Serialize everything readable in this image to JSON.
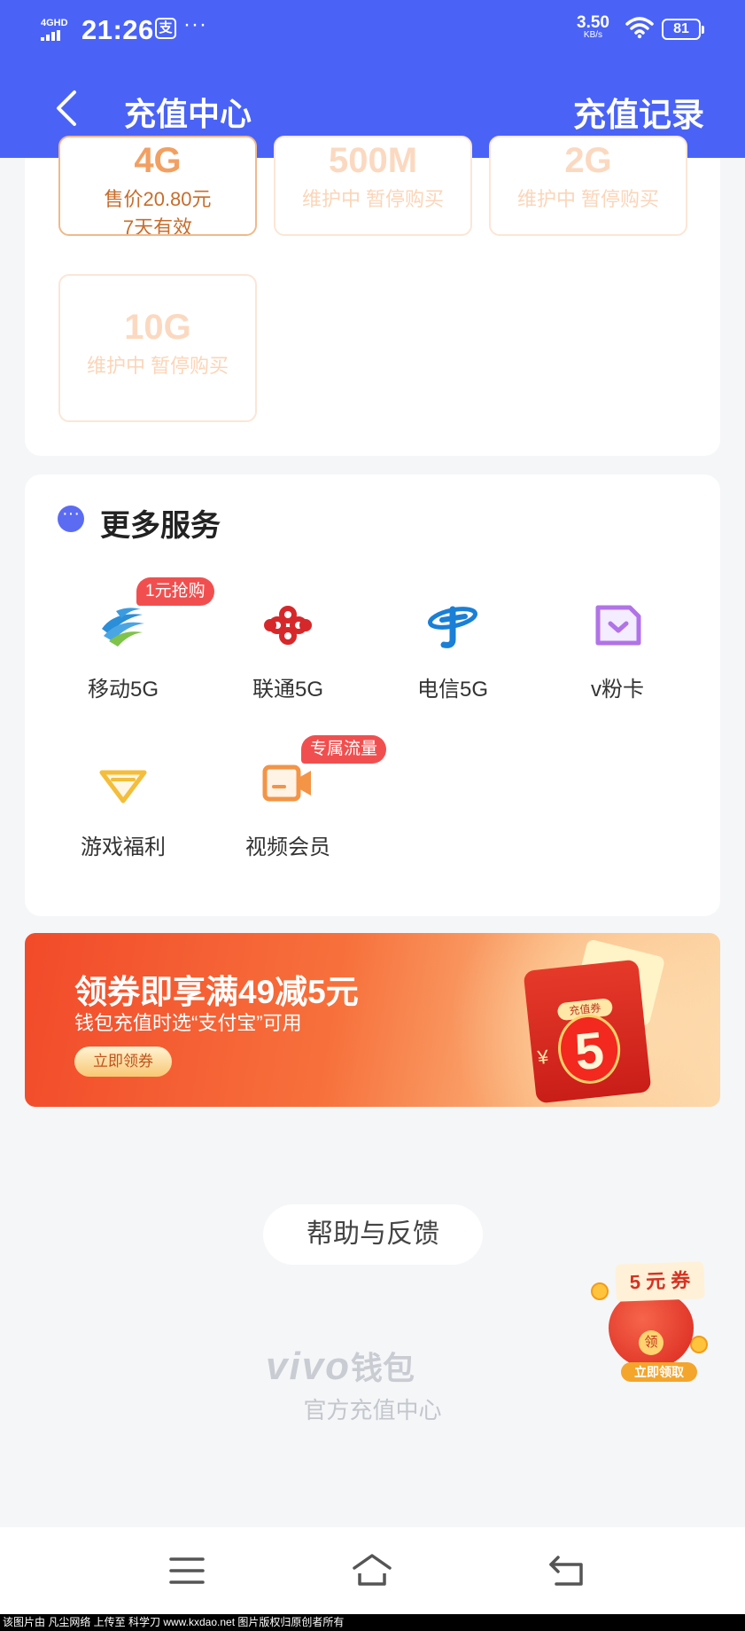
{
  "status_bar": {
    "network": "4GHD",
    "time": "21:26",
    "app_icon": "支",
    "more": "···",
    "speed_value": "3.50",
    "speed_unit": "KB/s",
    "battery": "81"
  },
  "header": {
    "title": "充值中心",
    "record_label": "充值记录"
  },
  "packages": [
    {
      "size": "4G",
      "price": "售价20.80元",
      "validity": "7天有效",
      "active": true
    },
    {
      "size": "500M",
      "price": "维护中 暂停购买",
      "validity": "",
      "active": false
    },
    {
      "size": "2G",
      "price": "维护中 暂停购买",
      "validity": "",
      "active": false
    },
    {
      "size": "10G",
      "price": "维护中 暂停购买",
      "validity": "",
      "active": false
    }
  ],
  "services": {
    "title": "更多服务",
    "items": [
      {
        "label": "移动5G",
        "icon": "china-mobile-icon",
        "badge": "1元抢购"
      },
      {
        "label": "联通5G",
        "icon": "china-unicom-icon",
        "badge": ""
      },
      {
        "label": "电信5G",
        "icon": "china-telecom-icon",
        "badge": ""
      },
      {
        "label": "v粉卡",
        "icon": "sim-card-icon",
        "badge": ""
      },
      {
        "label": "游戏福利",
        "icon": "diamond-icon",
        "badge": ""
      },
      {
        "label": "视频会员",
        "icon": "video-icon",
        "badge": "专属流量"
      }
    ]
  },
  "banner": {
    "headline": "领券即享满49减5元",
    "subline": "钱包充值时选“支付宝”可用",
    "cta": "立即领券",
    "tag": "充值券",
    "amount": "5",
    "currency": "¥"
  },
  "help_label": "帮助与反馈",
  "footer": {
    "logo_word": "vivo",
    "logo_cn": "钱包",
    "subtitle": "官方充值中心"
  },
  "float_coupon": {
    "title": "5 元 券",
    "seal": "领",
    "cta": "立即领取"
  },
  "watermark": "该图片由 凡尘网络 上传至 科学刀 www.kxdao.net 图片版权归原创者所有",
  "colors": {
    "header": "#4a63f6",
    "accent_orange": "#f2a062",
    "badge_red": "#f14f4f"
  }
}
